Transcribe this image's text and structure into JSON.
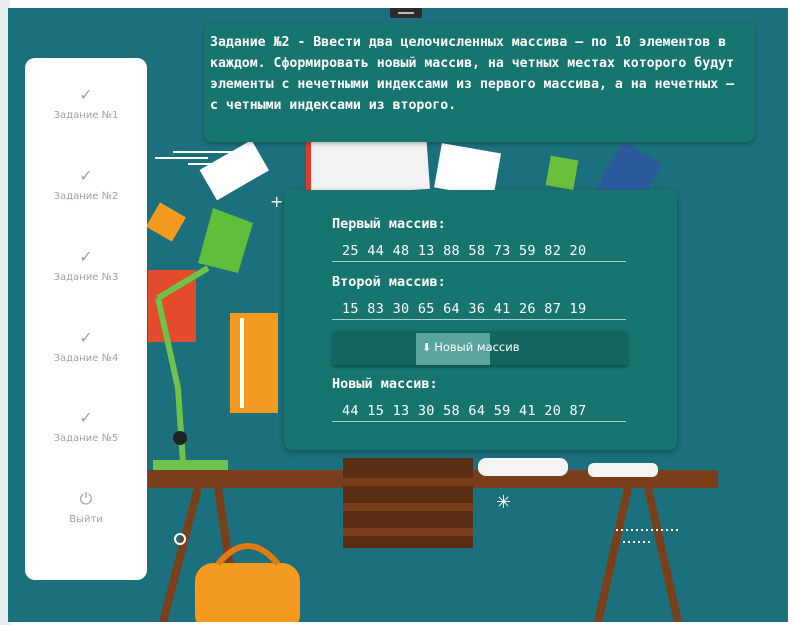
{
  "task": {
    "text": "Задание №2 - Ввести два целочисленных массива – по 10 элементов в каждом. Сформировать новый массив, на четных местах которого будут элементы с нечетными индексами из первого массива, а на нечетных – с четными индексами из второго."
  },
  "sidebar": {
    "items": [
      {
        "label": "Задание №1",
        "icon": "task-check-icon"
      },
      {
        "label": "Задание №2",
        "icon": "task-check-icon"
      },
      {
        "label": "Задание №3",
        "icon": "task-check-icon"
      },
      {
        "label": "Задание №4",
        "icon": "task-check-icon"
      },
      {
        "label": "Задание №5",
        "icon": "task-check-icon"
      },
      {
        "label": "Выйти",
        "icon": "power-icon"
      }
    ]
  },
  "panel": {
    "first_label": "Первый массив:",
    "first_values": "25 44 48 13 88 58 73 59 82 20",
    "second_label": "Второй массив:",
    "second_values": "15 83 30 65 64 36 41 26 87 19",
    "button_label": "Новый массив",
    "new_label": "Новый массив:",
    "new_values": "44 15 13 30 58 64 59 41 20 87"
  },
  "colors": {
    "background": "#1c6f7d",
    "panel": "#16756e",
    "sidebar": "#ffffff"
  }
}
